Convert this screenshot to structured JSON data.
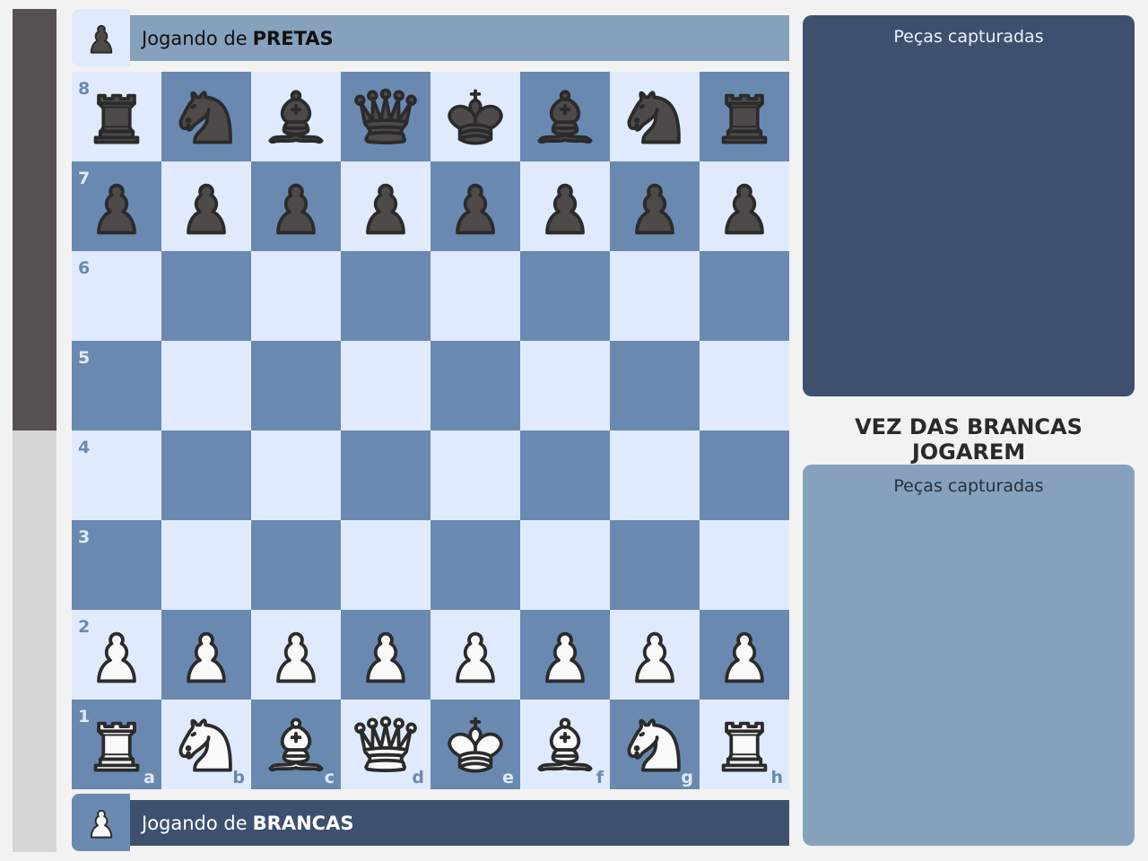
{
  "evaluation": {
    "black_share": 0.5
  },
  "top_player": {
    "prefix": "Jogando de",
    "side": "PRETAS",
    "avatar_icon": "black-pawn-icon"
  },
  "bottom_player": {
    "prefix": "Jogando de",
    "side": "BRANCAS",
    "avatar_icon": "white-pawn-icon"
  },
  "captured_top": {
    "label": "Peças capturadas"
  },
  "captured_bottom": {
    "label": "Peças capturadas"
  },
  "turn_text": "VEZ DAS BRANCAS JOGAREM",
  "colors": {
    "light_square": "#dfebfc",
    "dark_square": "#6a89b0",
    "panel_dark": "#3d516f",
    "panel_light": "#86a1bc"
  },
  "board": {
    "files": [
      "a",
      "b",
      "c",
      "d",
      "e",
      "f",
      "g",
      "h"
    ],
    "ranks": [
      "8",
      "7",
      "6",
      "5",
      "4",
      "3",
      "2",
      "1"
    ],
    "position": [
      [
        "bR",
        "bN",
        "bB",
        "bQ",
        "bK",
        "bB",
        "bN",
        "bR"
      ],
      [
        "bP",
        "bP",
        "bP",
        "bP",
        "bP",
        "bP",
        "bP",
        "bP"
      ],
      [
        "",
        "",
        "",
        "",
        "",
        "",
        "",
        ""
      ],
      [
        "",
        "",
        "",
        "",
        "",
        "",
        "",
        ""
      ],
      [
        "",
        "",
        "",
        "",
        "",
        "",
        "",
        ""
      ],
      [
        "",
        "",
        "",
        "",
        "",
        "",
        "",
        ""
      ],
      [
        "wP",
        "wP",
        "wP",
        "wP",
        "wP",
        "wP",
        "wP",
        "wP"
      ],
      [
        "wR",
        "wN",
        "wB",
        "wQ",
        "wK",
        "wB",
        "wN",
        "wR"
      ]
    ]
  }
}
